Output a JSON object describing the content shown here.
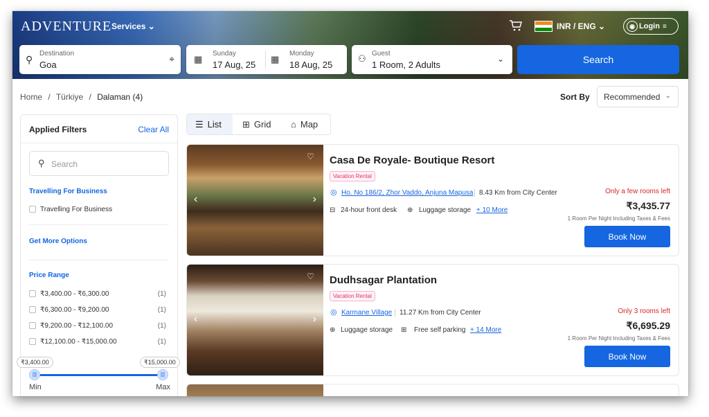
{
  "header": {
    "brand": "ADVENTURE",
    "services": "Services",
    "currency": "INR / ENG",
    "login": "Login"
  },
  "search": {
    "destination": {
      "label": "Destination",
      "value": "Goa"
    },
    "checkin": {
      "label": "Sunday",
      "value": "17 Aug, 25"
    },
    "checkout": {
      "label": "Monday",
      "value": "18 Aug, 25"
    },
    "guest": {
      "label": "Guest",
      "value": "1 Room, 2 Adults"
    },
    "button": "Search"
  },
  "breadcrumb": {
    "home": "Home",
    "sep": "/",
    "country": "Türkiye",
    "current": "Dalaman (4)"
  },
  "sort": {
    "label": "Sort By",
    "value": "Recommended"
  },
  "filters": {
    "title": "Applied Filters",
    "clear": "Clear All",
    "search_placeholder": "Search",
    "business": {
      "title": "Travelling For Business",
      "option": "Travelling For Business"
    },
    "more": "Get More Options",
    "price": {
      "title": "Price Range",
      "options": [
        {
          "label": "₹3,400.00 - ₹6,300.00",
          "count": "(1)"
        },
        {
          "label": "₹6,300.00 - ₹9,200.00",
          "count": "(1)"
        },
        {
          "label": "₹9,200.00 - ₹12,100.00",
          "count": "(1)"
        },
        {
          "label": "₹12,100.00 - ₹15,000.00",
          "count": "(1)"
        }
      ],
      "min_value": "₹3,400.00",
      "max_value": "₹15,000.00",
      "min_label": "Min",
      "max_label": "Max"
    }
  },
  "views": {
    "list": "List",
    "grid": "Grid",
    "map": "Map"
  },
  "hotels": [
    {
      "name": "Casa De Royale- Boutique Resort",
      "badge": "Vacation Rental",
      "address": "Ho. No 186/2, Zhor Vaddo, Anjuna Mapusa",
      "distance": "8.43 Km from City Center",
      "amenity1": "24-hour front desk",
      "amenity2": "Luggage storage",
      "more": "+ 10 More",
      "availability": "Only a few rooms left",
      "price": "₹3,435.77",
      "note": "1 Room Per Night Including Taxes & Fees",
      "book": "Book Now"
    },
    {
      "name": "Dudhsagar Plantation",
      "badge": "Vacation Rental",
      "address": "Karmane Village",
      "distance": "11.27 Km from City Center",
      "amenity1": "Luggage storage",
      "amenity2": "Free self parking",
      "more": "+ 14 More",
      "availability": "Only 3 rooms left",
      "price": "₹6,695.29",
      "note": "1 Room Per Night Including Taxes & Fees",
      "book": "Book Now"
    }
  ],
  "colors": {
    "primary": "#1566e0",
    "alert": "#d92525",
    "badge": "#e0306e"
  }
}
